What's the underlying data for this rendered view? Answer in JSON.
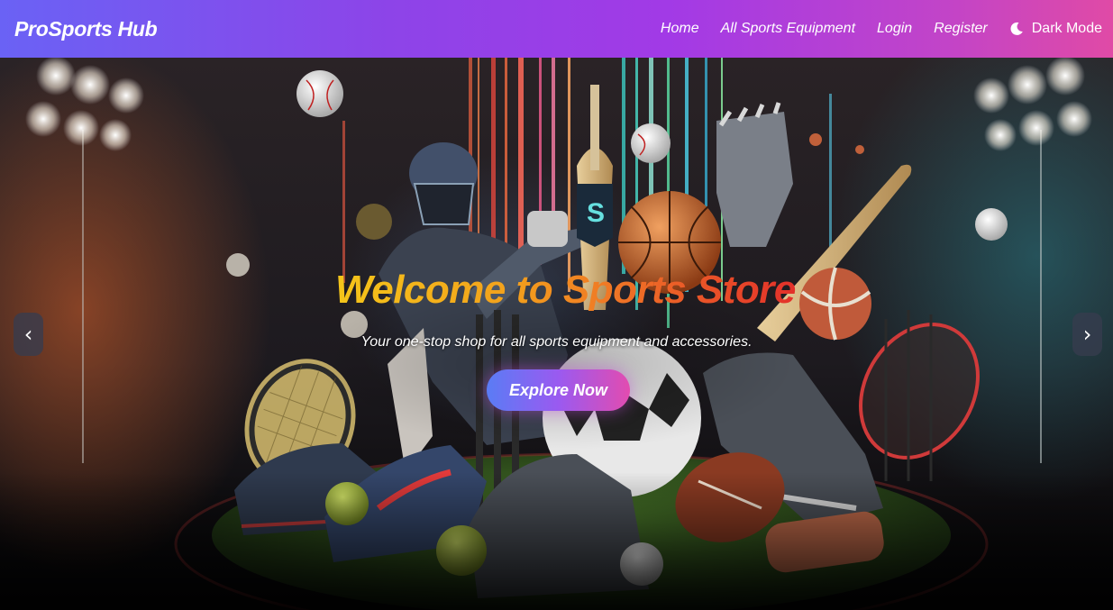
{
  "navbar": {
    "brand": "ProSports Hub",
    "links": [
      "Home",
      "All Sports Equipment",
      "Login",
      "Register"
    ],
    "dark_mode_label": "Dark Mode",
    "dark_mode_icon": "moon-icon",
    "gradient_colors": [
      "#6a62f5",
      "#a23ae6",
      "#e04aa6"
    ]
  },
  "hero": {
    "title": "Welcome to Sports Store",
    "subtitle": "Your one-stop shop for all sports equipment and accessories.",
    "cta_label": "Explore Now",
    "prev_symbol": "‹",
    "next_symbol": "›",
    "title_gradient": [
      "#f4c51a",
      "#ef7326",
      "#e3302a"
    ],
    "cta_gradient": [
      "#5a7cf5",
      "#9a5af0",
      "#e24cb0"
    ]
  }
}
